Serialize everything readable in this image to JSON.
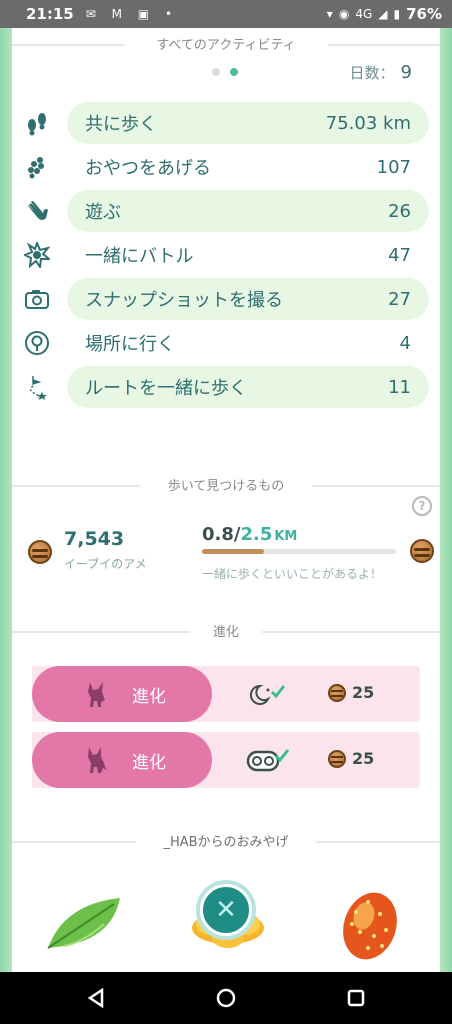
{
  "status_bar": {
    "time": "21:15",
    "notif_icons": "✉ M ▣ •",
    "signal_text": "4G",
    "battery": "76%"
  },
  "activities": {
    "section_title": "すべてのアクティビティ",
    "days_label": "日数：",
    "days_value": "9",
    "items": [
      {
        "label": "共に歩く",
        "value": "75.03 km",
        "icon": "footprints-icon"
      },
      {
        "label": "おやつをあげる",
        "value": "107",
        "icon": "berries-icon"
      },
      {
        "label": "遊ぶ",
        "value": "26",
        "icon": "hand-wave-icon"
      },
      {
        "label": "一緒にバトル",
        "value": "47",
        "icon": "battle-icon"
      },
      {
        "label": "スナップショットを撮る",
        "value": "27",
        "icon": "camera-icon"
      },
      {
        "label": "場所に行く",
        "value": "4",
        "icon": "location-icon"
      },
      {
        "label": "ルートを一緒に歩く",
        "value": "11",
        "icon": "route-icon"
      }
    ]
  },
  "walk": {
    "section_title": "歩いて見つけるもの",
    "help_icon": "?",
    "candy_count": "7,543",
    "candy_label": "イーブイのアメ",
    "distance_current": "0.8",
    "distance_sep": "/",
    "distance_target": "2.5",
    "distance_unit": "KM",
    "progress": 0.32,
    "hint": "一緒に歩くといいことがあるよ！"
  },
  "evolution": {
    "section_title": "進化",
    "rows": [
      {
        "label": "進化",
        "requirement_icon": "night-check-icon",
        "cost": "25"
      },
      {
        "label": "進化",
        "requirement_icon": "dual-faces-check-icon",
        "cost": "25"
      }
    ]
  },
  "souvenirs": {
    "section_title": "_HABからのおみやげ",
    "items": [
      "leaf-item",
      "flower-item",
      "cactus-fruit-item"
    ]
  },
  "colors": {
    "accent": "#53b99a",
    "evo_pink": "#e378a8",
    "row_shade": "#e8f7e4",
    "text": "#2f6f6f"
  }
}
